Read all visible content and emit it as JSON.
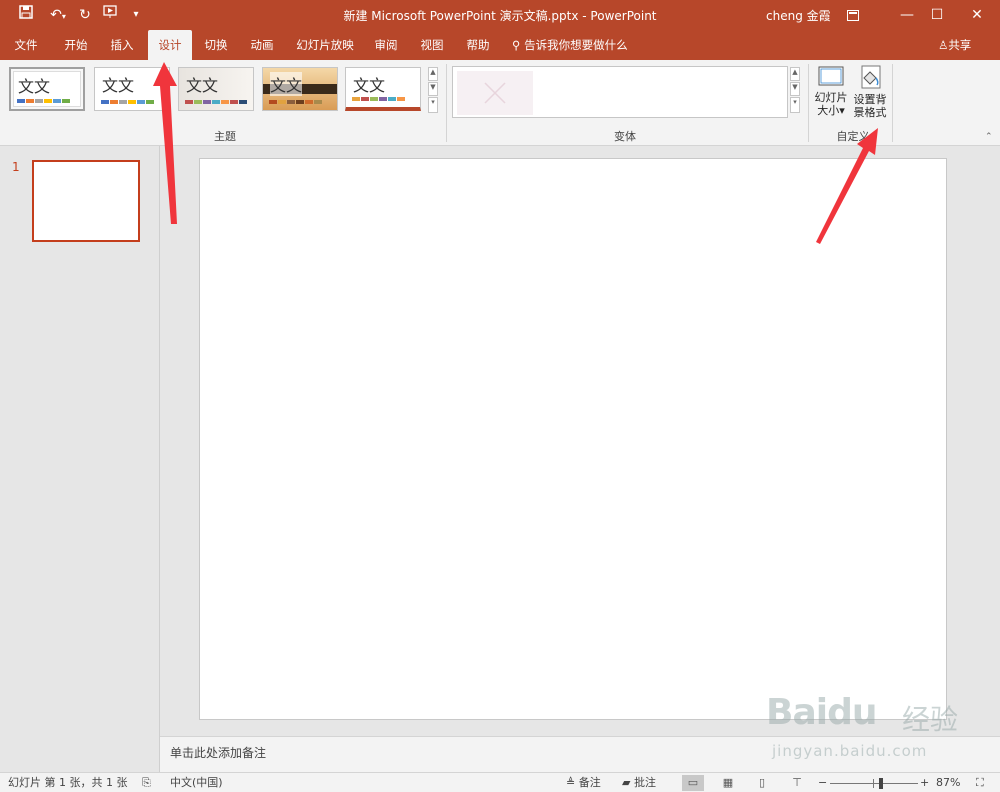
{
  "titlebar": {
    "title": "新建 Microsoft PowerPoint 演示文稿.pptx  -  PowerPoint",
    "user": "cheng 金霞"
  },
  "tabs": [
    {
      "id": "file",
      "label": "文件"
    },
    {
      "id": "home",
      "label": "开始"
    },
    {
      "id": "insert",
      "label": "插入"
    },
    {
      "id": "design",
      "label": "设计",
      "active": true
    },
    {
      "id": "transitions",
      "label": "切换"
    },
    {
      "id": "animations",
      "label": "动画"
    },
    {
      "id": "slideshow",
      "label": "幻灯片放映"
    },
    {
      "id": "review",
      "label": "审阅"
    },
    {
      "id": "view",
      "label": "视图"
    },
    {
      "id": "help",
      "label": "帮助"
    }
  ],
  "tellme": "告诉我你想要做什么",
  "share": "共享",
  "ribbon": {
    "themes_group_label": "主题",
    "variants_group_label": "变体",
    "customize_group_label": "自定义",
    "theme_thumbnail_text": "文文",
    "slide_size_label": [
      "幻灯片",
      "大小▾"
    ],
    "format_background_label": [
      "设置背",
      "景格式"
    ]
  },
  "thumbnail": {
    "slide_number": "1"
  },
  "notes_placeholder": "单击此处添加备注",
  "statusbar": {
    "slide_info": "幻灯片 第 1 张，共 1 张",
    "language": "中文(中国)",
    "notes": "备注",
    "comments": "批注",
    "zoom_minus": "−",
    "zoom_plus": "+",
    "zoom_level": "87%",
    "zoom_fraction": 0.58
  },
  "watermark": {
    "brand": "Baidu",
    "brand_cn": "经验",
    "url": "jingyan.baidu.com"
  },
  "colors": {
    "accent": "#b7472a",
    "annotation_arrow": "#f0353c"
  }
}
